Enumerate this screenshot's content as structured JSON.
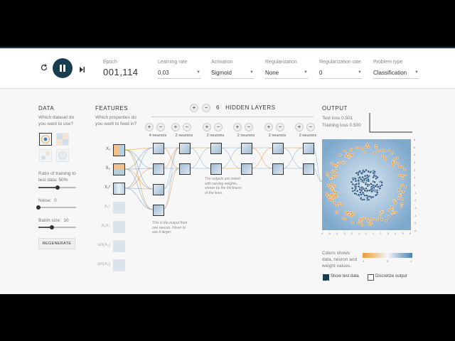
{
  "epoch": {
    "label": "Epoch",
    "value": "001,114"
  },
  "controls": {
    "learning_rate": {
      "label": "Learning rate",
      "value": "0.03"
    },
    "activation": {
      "label": "Activation",
      "value": "Sigmoid"
    },
    "regularization": {
      "label": "Regularization",
      "value": "None"
    },
    "regularization_rate": {
      "label": "Regularization rate",
      "value": "0"
    },
    "problem_type": {
      "label": "Problem type",
      "value": "Classification"
    }
  },
  "data_panel": {
    "title": "DATA",
    "question": "Which dataset do you want to use?",
    "ratio_label": "Ratio of training to test data:",
    "ratio_value": "50%",
    "ratio_fraction": 0.5,
    "noise_label": "Noise:",
    "noise_value": "0",
    "noise_fraction": 0.0,
    "batch_label": "Batch size:",
    "batch_value": "10",
    "batch_fraction": 0.35,
    "regenerate": "REGENERATE"
  },
  "features_panel": {
    "title": "FEATURES",
    "question": "Which properties do you want to feed in?",
    "items": [
      {
        "label": "X₁",
        "active": true
      },
      {
        "label": "X₂",
        "active": true
      },
      {
        "label": "X₁²",
        "active": true
      },
      {
        "label": "X₂²",
        "active": false
      },
      {
        "label": "X₁X₂",
        "active": false
      },
      {
        "label": "sin(X₁)",
        "active": false
      },
      {
        "label": "sin(X₂)",
        "active": false
      }
    ]
  },
  "hidden": {
    "count": "6",
    "title": "HIDDEN LAYERS",
    "plus": "+",
    "minus": "−",
    "layers": [
      {
        "label": "4 neurons",
        "neurons": 4
      },
      {
        "label": "2 neurons",
        "neurons": 2
      },
      {
        "label": "2 neurons",
        "neurons": 2
      },
      {
        "label": "2 neurons",
        "neurons": 2
      },
      {
        "label": "2 neurons",
        "neurons": 2
      },
      {
        "label": "2 neurons",
        "neurons": 2
      }
    ],
    "note_neuron": "This is the output from one neuron. Hover to see it larger.",
    "note_weights": "The outputs are mixed with varying weights, shown by the thickness of the lines."
  },
  "output": {
    "title": "OUTPUT",
    "test_loss": "Test loss 0.501",
    "training_loss": "Training loss 0.500",
    "legend_text": "Colors shows data, neuron and weight values.",
    "legend_ticks": [
      "-1",
      "0",
      "1"
    ],
    "axis_ticks": [
      "-6",
      "-5",
      "-4",
      "-3",
      "-2",
      "-1",
      "0",
      "1",
      "2",
      "3",
      "4",
      "5",
      "6"
    ],
    "show_test_data": {
      "label": "Show test data",
      "checked": true
    },
    "discretize": {
      "label": "Discretize output",
      "checked": false
    }
  },
  "colors": {
    "accent": "#183d4e",
    "blue": "#4a84b8",
    "orange": "#e89a3c"
  }
}
